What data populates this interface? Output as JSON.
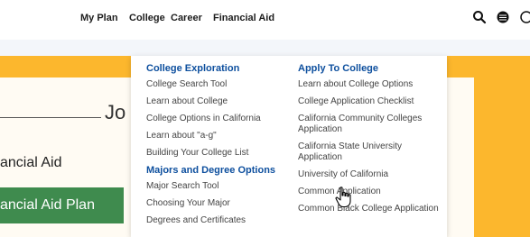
{
  "nav": {
    "items": [
      {
        "label": "My Plan"
      },
      {
        "label": "College"
      },
      {
        "label": "Career"
      },
      {
        "label": "Financial Aid"
      }
    ]
  },
  "icons": {
    "search": "search-icon",
    "language": "globe-icon",
    "more": "more-icon"
  },
  "page": {
    "title": "Jo",
    "subtitle": "ancial Aid",
    "plan_button": "ancial Aid Plan"
  },
  "dropdown": {
    "left": {
      "heading1": "College Exploration",
      "links1": [
        "College Search Tool",
        "Learn about College",
        "College Options in California",
        "Learn about \"a-g\"",
        "Building Your College List"
      ],
      "heading2": "Majors and Degree Options",
      "links2": [
        "Major Search Tool",
        "Choosing Your Major",
        "Degrees and Certificates"
      ]
    },
    "right": {
      "heading": "Apply To College",
      "links": [
        "Learn about College Options",
        "College Application Checklist",
        "California Community Colleges Application",
        "California State University Application",
        "University of California",
        "Common Application",
        "Common Black College Application"
      ]
    }
  },
  "colors": {
    "banner": "#fcb72d",
    "heading_blue": "#0d4f9e",
    "button_green": "#3f8b4e"
  }
}
